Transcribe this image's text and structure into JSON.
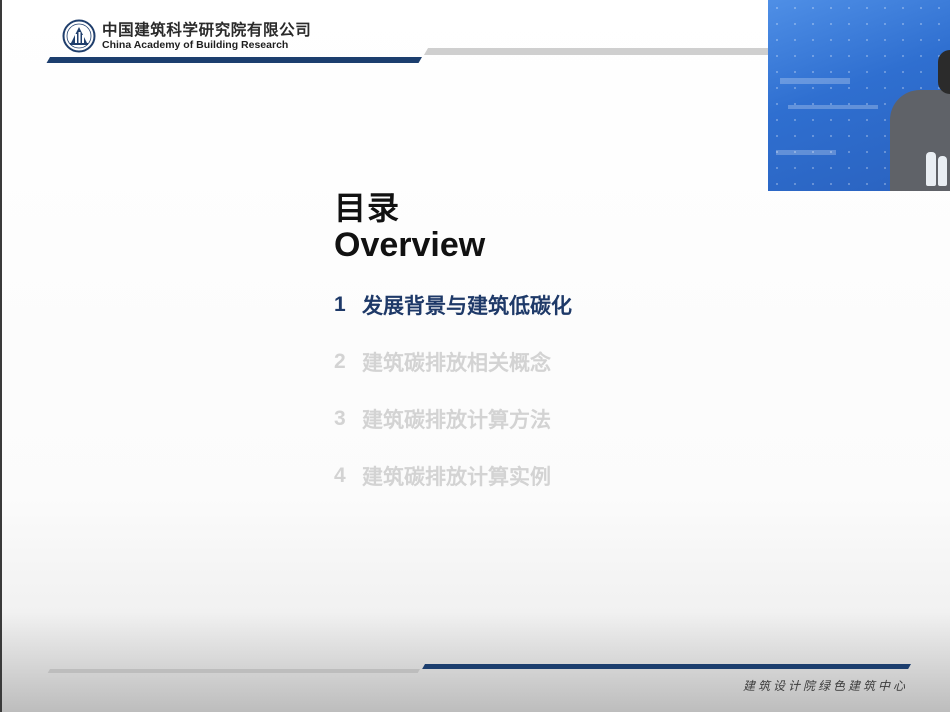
{
  "header": {
    "org_name_cn": "中国建筑科学研究院有限公司",
    "org_name_en": "China Academy of Building Research",
    "logo_icon": "cabr-logo-icon"
  },
  "title": {
    "cn": "目录",
    "en": "Overview"
  },
  "toc": {
    "items": [
      {
        "num": "1",
        "label": "发展背景与建筑低碳化",
        "state": "active"
      },
      {
        "num": "2",
        "label": "建筑碳排放相关概念",
        "state": "inactive"
      },
      {
        "num": "3",
        "label": "建筑碳排放计算方法",
        "state": "inactive"
      },
      {
        "num": "4",
        "label": "建筑碳排放计算实例",
        "state": "inactive"
      }
    ]
  },
  "footer": {
    "text": "建筑设计院绿色建筑中心"
  },
  "colors": {
    "accent": "#1e3968",
    "inactive_text": "#d3d3d3",
    "header_bar": "#1c3e6e",
    "webcam_bg": "#2f6fd0"
  }
}
